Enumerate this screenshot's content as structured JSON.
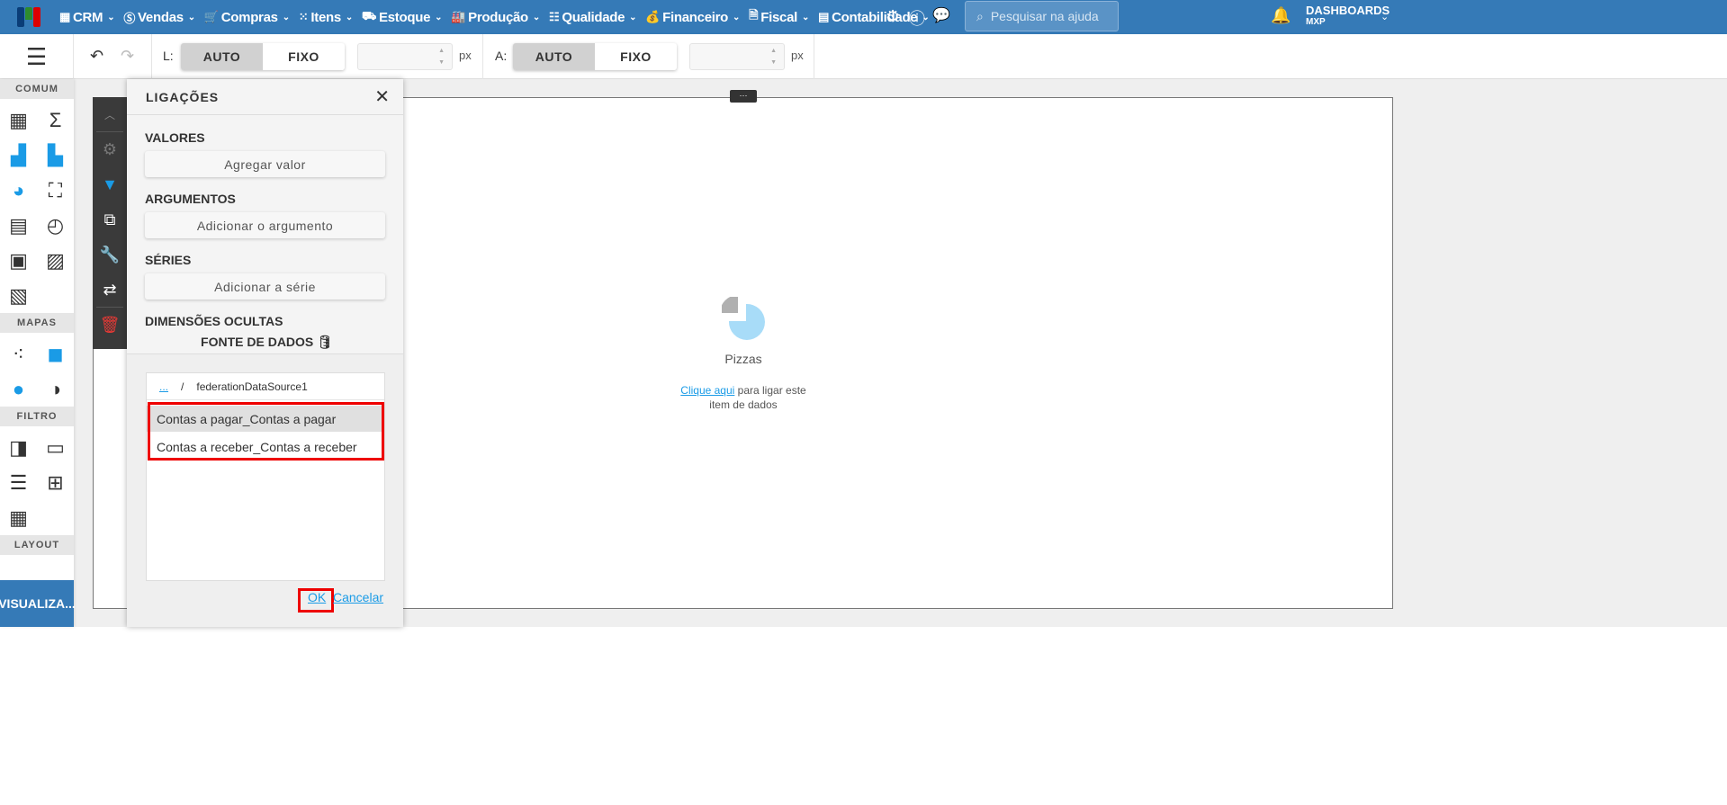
{
  "nav": {
    "items": [
      {
        "icon": "building-icon",
        "label": "CRM"
      },
      {
        "icon": "dollar-icon",
        "label": "Vendas"
      },
      {
        "icon": "cart-icon",
        "label": "Compras"
      },
      {
        "icon": "items-icon",
        "label": "Itens"
      },
      {
        "icon": "dolly-icon",
        "label": "Estoque"
      },
      {
        "icon": "factory-icon",
        "label": "Produção"
      },
      {
        "icon": "checklist-icon",
        "label": "Qualidade"
      },
      {
        "icon": "money-bag-icon",
        "label": "Financeiro"
      },
      {
        "icon": "document-icon",
        "label": "Fiscal"
      },
      {
        "icon": "calculator-icon",
        "label": "Contabilidade"
      }
    ],
    "search_placeholder": "Pesquisar na ajuda",
    "user": {
      "title": "DASHBOARDS",
      "subtitle": "MXP"
    },
    "colors": {
      "brand": "#357ab7",
      "accent": "#1a9be6",
      "highlight": "#e00000"
    }
  },
  "toolbar": {
    "width_label": "L:",
    "height_label": "A:",
    "auto": "AUTO",
    "fixo": "FIXO",
    "unit": "px",
    "width_value": "",
    "height_value": ""
  },
  "sidebar": {
    "sections": [
      "COMUM",
      "MAPAS",
      "FILTRO",
      "LAYOUT"
    ],
    "visualize": "VISUALIZA..."
  },
  "panel": {
    "title": "LIGAÇÕES",
    "valores": "VALORES",
    "agregar": "Agregar valor",
    "argumentos": "ARGUMENTOS",
    "add_arg": "Adicionar o argumento",
    "series": "SÉRIES",
    "add_series": "Adicionar a série",
    "hidden": "DIMENSÕES OCULTAS",
    "datasource": "FONTE DE DADOS",
    "crumb_up": "...",
    "crumb_sep": "/",
    "crumb_current": "federationDataSource1",
    "rows": [
      "Contas a pagar_Contas a pagar",
      "Contas a receber_Contas a receber"
    ],
    "ok": "OK",
    "cancel": "Cancelar"
  },
  "placeholder": {
    "title": "Pizzas",
    "link": "Clique aqui",
    "text1": " para ligar este",
    "text2": "item de dados"
  }
}
